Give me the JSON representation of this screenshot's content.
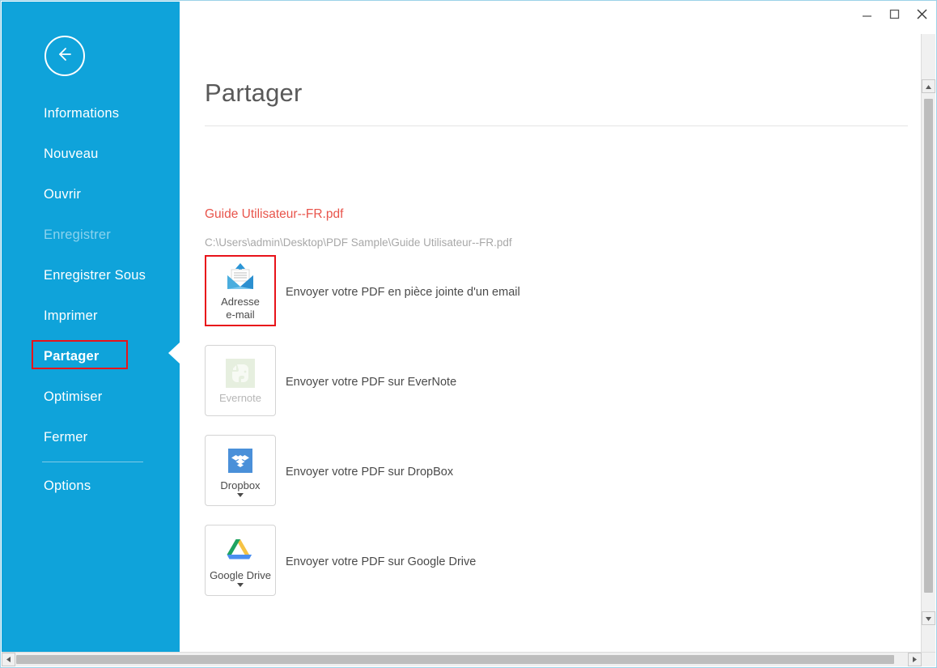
{
  "window": {
    "controls": {
      "minimize_label": "Minimiser",
      "maximize_label": "Agrandir",
      "close_label": "Fermer"
    }
  },
  "sidebar": {
    "back_label": "Retour",
    "accent_color": "#0fa3da",
    "items": [
      {
        "label": "Informations",
        "state": "normal"
      },
      {
        "label": "Nouveau",
        "state": "normal"
      },
      {
        "label": "Ouvrir",
        "state": "normal"
      },
      {
        "label": "Enregistrer",
        "state": "disabled"
      },
      {
        "label": "Enregistrer Sous",
        "state": "normal"
      },
      {
        "label": "Imprimer",
        "state": "normal"
      },
      {
        "label": "Partager",
        "state": "active"
      },
      {
        "label": "Optimiser",
        "state": "normal"
      },
      {
        "label": "Fermer",
        "state": "normal"
      }
    ],
    "options_label": "Options",
    "highlight_color": "#e8131a"
  },
  "main": {
    "title": "Partager",
    "document": {
      "name": "Guide Utilisateur--FR.pdf",
      "name_color": "#e8544b",
      "path": "C:\\Users\\admin\\Desktop\\PDF Sample\\Guide Utilisateur--FR.pdf"
    },
    "share_options": [
      {
        "tile_label": "Adresse\ne-mail",
        "description": "Envoyer votre PDF en pièce jointe d'un email",
        "icon": "envelope-upload-icon",
        "selected": true,
        "disabled": false,
        "has_dropdown": false
      },
      {
        "tile_label": "Evernote",
        "description": "Envoyer votre PDF sur EverNote",
        "icon": "evernote-icon",
        "selected": false,
        "disabled": true,
        "has_dropdown": false
      },
      {
        "tile_label": "Dropbox",
        "description": "Envoyer votre PDF sur DropBox",
        "icon": "dropbox-icon",
        "selected": false,
        "disabled": false,
        "has_dropdown": true
      },
      {
        "tile_label": "Google Drive",
        "description": "Envoyer votre PDF sur Google Drive",
        "icon": "google-drive-icon",
        "selected": false,
        "disabled": false,
        "has_dropdown": true
      }
    ]
  },
  "scrollbars": {
    "vertical": {
      "up_label": "Défiler vers le haut",
      "down_label": "Défiler vers le bas"
    },
    "horizontal": {
      "left_label": "Défiler à gauche",
      "right_label": "Défiler à droite"
    }
  }
}
